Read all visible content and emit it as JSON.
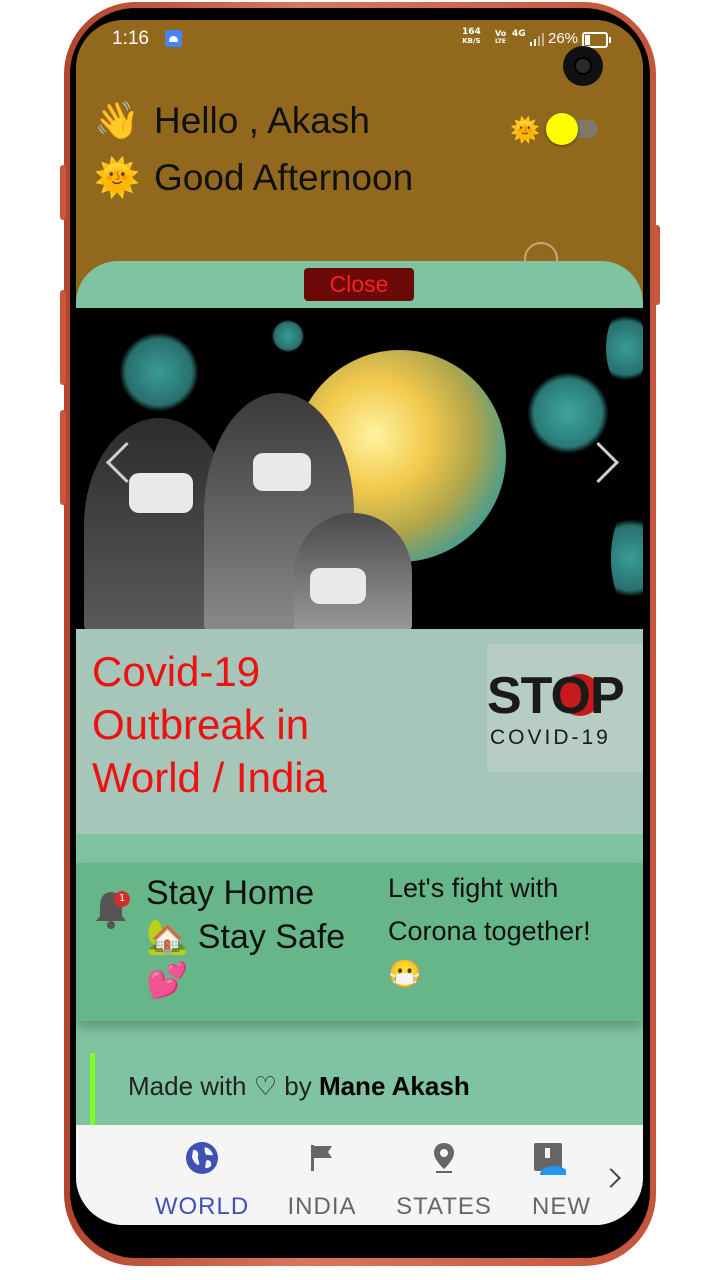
{
  "status_bar": {
    "time": "1:16",
    "net_speed": "164",
    "net_unit": "KB/S",
    "volte_top": "Vo",
    "volte_bottom": "LTE",
    "network_type": "4G",
    "battery_percent": "26%"
  },
  "header": {
    "greeting_emoji": "👋",
    "greeting": "Hello , Akash",
    "time_emoji": "🌞",
    "time_greeting": "Good Afternoon",
    "theme_icon": "🌞"
  },
  "sheet": {
    "close_label": "Close",
    "title": "Covid-19\nOutbreak in\nWorld / India",
    "stop_word": "STOP",
    "stop_sub": "COVID-19",
    "notification_count": "1",
    "stay_message": "Stay Home\n🏡 Stay Safe\n💕",
    "fight_message": "Let's fight with\nCorona together!\n😷",
    "footer_prefix": "Made with ♡ by ",
    "footer_author": "Mane Akash"
  },
  "bottom_nav": {
    "items": [
      {
        "label": "WORLD",
        "icon": "globe-icon",
        "active": true
      },
      {
        "label": "INDIA",
        "icon": "flag-icon",
        "active": false
      },
      {
        "label": "STATES",
        "icon": "location-pin-icon",
        "active": false
      },
      {
        "label": "NEW",
        "icon": "news-icon",
        "active": false
      }
    ]
  },
  "colors": {
    "header_bg": "#92691c",
    "accent_red": "#ee1111",
    "nav_active": "#3f51b5",
    "card_green": "#66b68a",
    "toggle_knob": "#ffff00"
  }
}
